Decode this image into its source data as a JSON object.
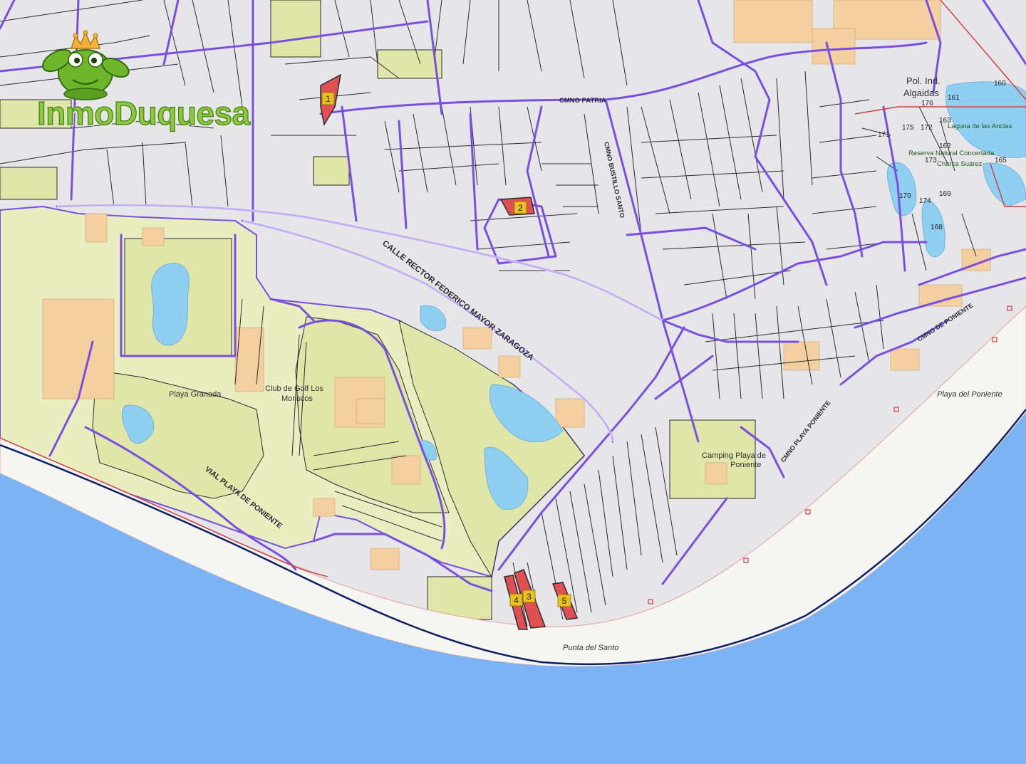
{
  "brand": {
    "name": "InmoDuquesa",
    "colors": {
      "text": "#8dc63f",
      "outline": "#3c7a12",
      "crown": "#f4b23a"
    }
  },
  "map": {
    "colors": {
      "sea": "#7ab4f5",
      "coast_line": "#0c1f66",
      "beach": "#f5f5f2",
      "land": "#e6e6e8",
      "parks": "#e9eec0",
      "greens": "#dfe6a8",
      "water": "#8fd0f2",
      "buildings": "#f4cfa0",
      "roads": "#7a4ee0",
      "parcel_lines": "#2a2a36",
      "highlight": "#e05050",
      "marker": "#e8c020"
    },
    "street_labels": [
      {
        "id": "calle-rector",
        "text": "CALLE RECTOR FEDERICO MAYOR ZARAGOZA"
      },
      {
        "id": "vial-playa",
        "text": "VIAL PLAYA DE PONIENTE"
      },
      {
        "id": "camino-patria",
        "text": "CMNO PATRIA"
      },
      {
        "id": "vertical-street",
        "text": "CMNO BUSTILLO SANTO"
      },
      {
        "id": "cmno-poniente",
        "text": "CMNO DE PONIENTE"
      },
      {
        "id": "cmno-playa",
        "text": "CMNO PLAYA PONIENTE"
      }
    ],
    "place_labels": [
      {
        "id": "playa-granada",
        "text": "Playa Granada"
      },
      {
        "id": "club-golf",
        "text": "Club de Golf Los Moriscos"
      },
      {
        "id": "camping",
        "text": "Camping Playa de Poniente"
      },
      {
        "id": "punta-santo",
        "text": "Punta del Santo"
      },
      {
        "id": "playa-poniente",
        "text": "Playa del Poniente"
      },
      {
        "id": "pol-ind",
        "text": "Pol. Ind. Algaidas"
      },
      {
        "id": "laguna",
        "text": "Laguna de las Anclas"
      },
      {
        "id": "reserva",
        "text": "Reserva Natural Concertada Charca Suárez"
      }
    ],
    "parcel_numbers": [
      "160",
      "161",
      "176",
      "171",
      "175",
      "172",
      "163",
      "162",
      "173",
      "165",
      "170",
      "174",
      "169",
      "168"
    ],
    "markers": [
      {
        "id": "1",
        "label": "1"
      },
      {
        "id": "2",
        "label": "2"
      },
      {
        "id": "3",
        "label": "3"
      },
      {
        "id": "4",
        "label": "4"
      },
      {
        "id": "5",
        "label": "5"
      }
    ]
  }
}
